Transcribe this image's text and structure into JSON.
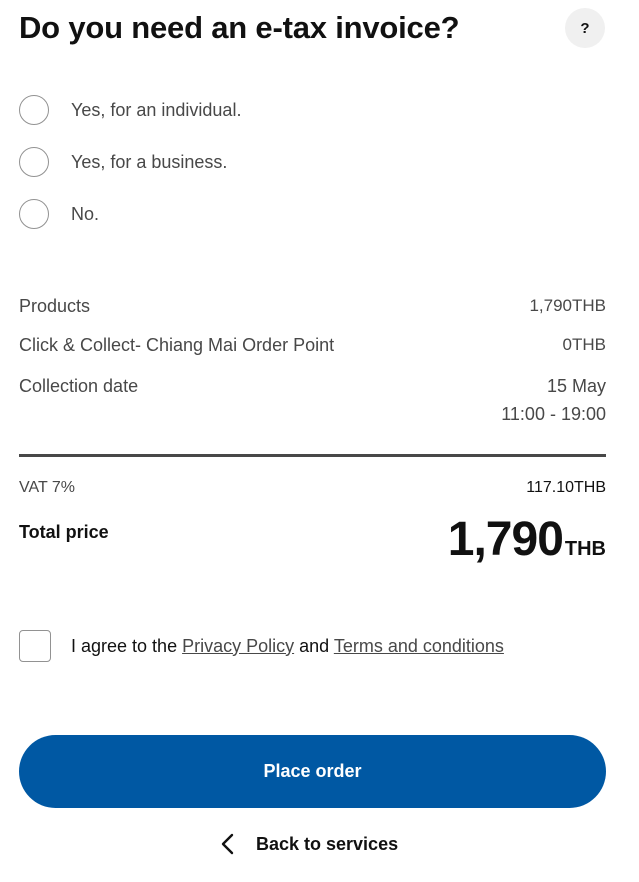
{
  "header": {
    "title": "Do you need an e-tax invoice?",
    "help_label": "?"
  },
  "invoice_options": [
    {
      "label": "Yes, for an individual."
    },
    {
      "label": "Yes, for a business."
    },
    {
      "label": "No."
    }
  ],
  "summary": {
    "products_label": "Products",
    "products_value": "1,790THB",
    "collect_label": "Click & Collect- Chiang Mai Order Point",
    "collect_value": "0THB",
    "collection_date_label": "Collection date",
    "collection_date_value": "15 May",
    "collection_time_value": "11:00 - 19:00"
  },
  "totals": {
    "vat_label": "VAT 7%",
    "vat_value": "117.10THB",
    "total_label": "Total price",
    "total_amount": "1,790",
    "total_currency": "THB"
  },
  "agreement": {
    "prefix": "I agree to the ",
    "privacy_link": "Privacy Policy",
    "middle": " and ",
    "terms_link": "Terms and conditions"
  },
  "actions": {
    "place_order_label": "Place order",
    "back_label": "Back to services"
  },
  "colors": {
    "primary_button": "#0058a3",
    "text_dark": "#111111",
    "text_muted": "#484848"
  }
}
